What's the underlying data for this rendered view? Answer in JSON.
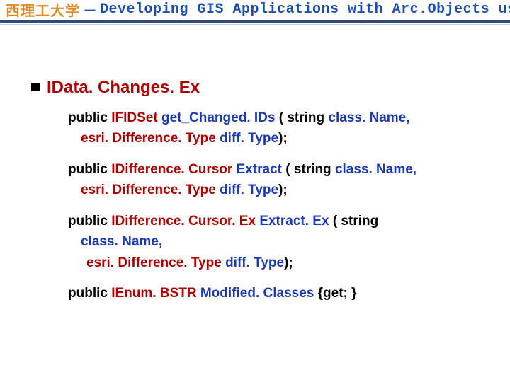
{
  "header": {
    "cn": "西理工大学",
    "sep": "－",
    "en": "Developing GIS Applications with Arc.Objects using C#. NE"
  },
  "bullet": {
    "title": "IData. Changes. Ex"
  },
  "sigs": [
    {
      "kw1": "public ",
      "typ1": "IFIDSet ",
      "nm": "get_Changed. IDs ",
      "kw2": "( string ",
      "nm2": "class. Name,",
      "line2_typ": "esri. Difference. Type ",
      "line2_nm": "diff. Type",
      "line2_kw": ");"
    },
    {
      "kw1": "public ",
      "typ1": "IDifference. Cursor ",
      "nm": "Extract ",
      "kw2": "( string ",
      "nm2": "class. Name,",
      "line2_typ": "esri. Difference. Type ",
      "line2_nm": "diff. Type",
      "line2_kw": ");"
    },
    {
      "kw1": "public ",
      "typ1": "IDifference. Cursor. Ex ",
      "nm": "Extract. Ex ",
      "kw2": "( string",
      "nm2": "",
      "line2a_nm": "class. Name,",
      "line2_typ": "esri. Difference. Type ",
      "line2_nm": "diff. Type",
      "line2_kw": ");"
    },
    {
      "kw1": "public ",
      "typ1": "IEnum. BSTR ",
      "nm": "Modified. Classes ",
      "kw2": "{get; }",
      "nm2": ""
    }
  ]
}
